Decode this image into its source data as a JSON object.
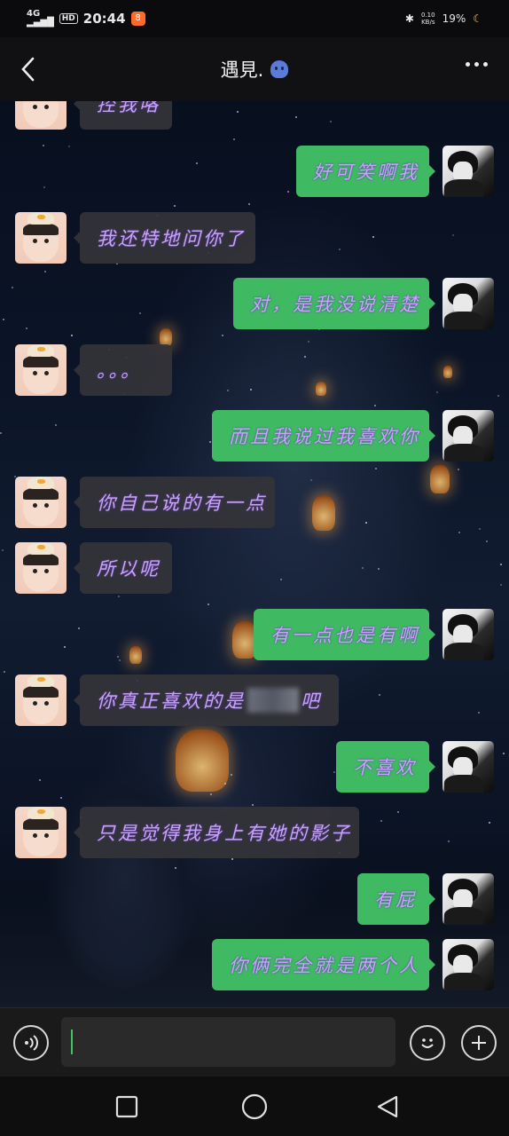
{
  "status_bar": {
    "network": "4G",
    "hd": "HD",
    "time": "20:44",
    "app_badge": "8",
    "speed_top": "0.10",
    "speed_bottom": "KB/s",
    "battery": "19%"
  },
  "header": {
    "title": "遇見."
  },
  "messages": [
    {
      "side": "in",
      "text": "控我咯"
    },
    {
      "side": "out",
      "text": "好可笑啊我"
    },
    {
      "side": "in",
      "text": "我还特地问你了"
    },
    {
      "side": "out",
      "text": "对，是我没说清楚"
    },
    {
      "side": "in",
      "text": "。。。"
    },
    {
      "side": "out",
      "text": "而且我说过我喜欢你"
    },
    {
      "side": "in",
      "text": "你自己说的有一点"
    },
    {
      "side": "in",
      "text": "所以呢"
    },
    {
      "side": "out",
      "text": "有一点也是有啊"
    },
    {
      "side": "in",
      "text_before": "你真正喜欢的是",
      "text_after": "吧"
    },
    {
      "side": "out",
      "text": "不喜欢"
    },
    {
      "side": "in",
      "text": "只是觉得我身上有她的影子"
    },
    {
      "side": "out",
      "text": "有屁"
    },
    {
      "side": "out",
      "text": "你俩完全就是两个人"
    }
  ],
  "input": {
    "value": "",
    "placeholder": ""
  },
  "icons": {
    "back": "chevron-left-icon",
    "more": "more-dots-icon",
    "voice": "voice-icon",
    "emoji": "emoji-icon",
    "plus": "plus-icon",
    "nav_recent": "square-icon",
    "nav_home": "circle-icon",
    "nav_back": "triangle-back-icon"
  },
  "colors": {
    "outgoing_bubble": "#3fba63",
    "incoming_bubble": "#343438",
    "bubble_text": "#c7a3f5"
  }
}
